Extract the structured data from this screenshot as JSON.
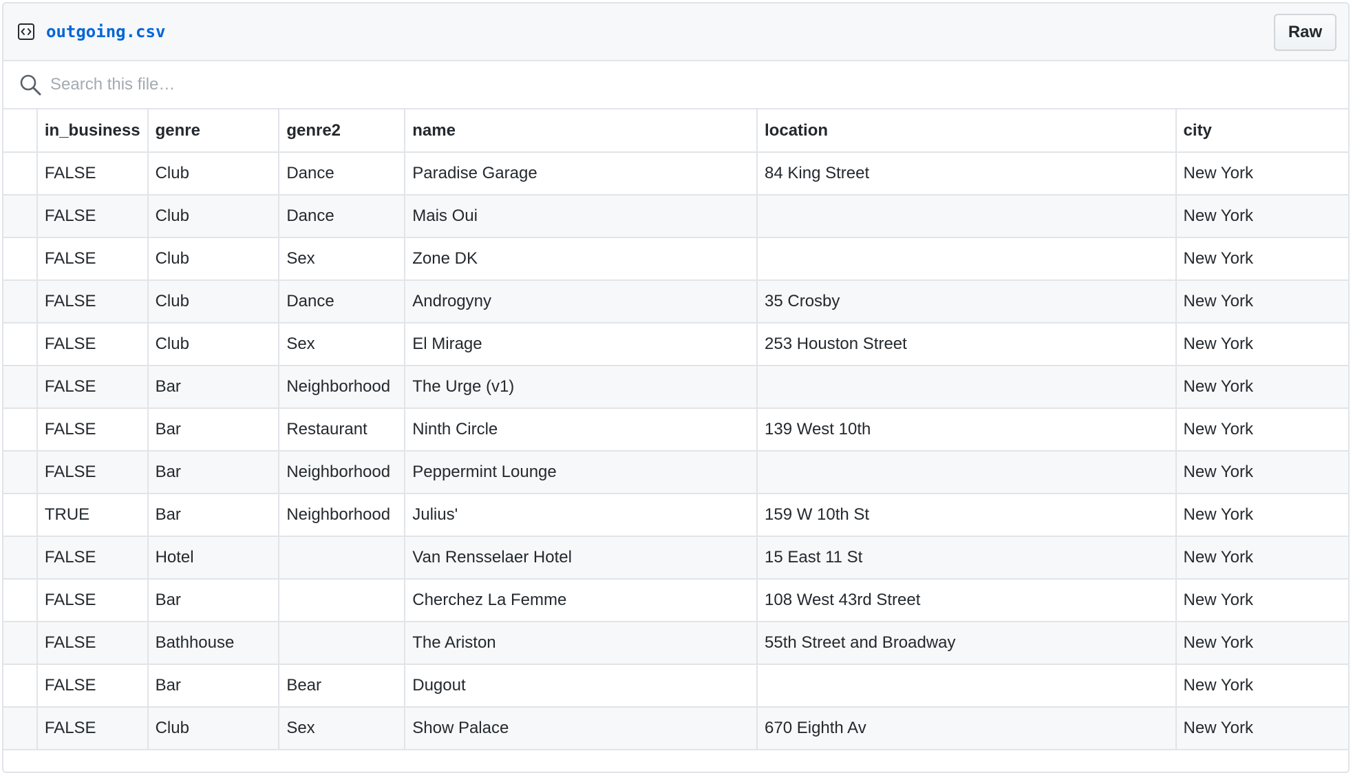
{
  "file": {
    "name": "outgoing.csv",
    "raw_label": "Raw"
  },
  "search": {
    "placeholder": "Search this file…",
    "value": ""
  },
  "icons": {
    "file_icon": "file-code-icon",
    "search_icon": "search-icon"
  },
  "colors": {
    "link": "#0366d6",
    "border": "#e1e4e8",
    "header_bg": "#f6f8fa",
    "stripe_bg": "#f6f8fa",
    "text": "#24292e",
    "placeholder": "#a3aab1"
  },
  "table": {
    "columns": [
      "in_business",
      "genre",
      "genre2",
      "name",
      "location",
      "city"
    ],
    "rows": [
      [
        "FALSE",
        "Club",
        "Dance",
        "Paradise Garage",
        "84 King Street",
        "New York"
      ],
      [
        "FALSE",
        "Club",
        "Dance",
        "Mais Oui",
        "",
        "New York"
      ],
      [
        "FALSE",
        "Club",
        "Sex",
        "Zone DK",
        "",
        "New York"
      ],
      [
        "FALSE",
        "Club",
        "Dance",
        "Androgyny",
        "35 Crosby",
        "New York"
      ],
      [
        "FALSE",
        "Club",
        "Sex",
        "El Mirage",
        "253 Houston Street",
        "New York"
      ],
      [
        "FALSE",
        "Bar",
        "Neighborhood",
        "The Urge (v1)",
        "",
        "New York"
      ],
      [
        "FALSE",
        "Bar",
        "Restaurant",
        "Ninth Circle",
        "139 West 10th",
        "New York"
      ],
      [
        "FALSE",
        "Bar",
        "Neighborhood",
        "Peppermint Lounge",
        "",
        "New York"
      ],
      [
        "TRUE",
        "Bar",
        "Neighborhood",
        "Julius'",
        "159 W 10th St",
        "New York"
      ],
      [
        "FALSE",
        "Hotel",
        "",
        "Van Rensselaer Hotel",
        "15 East 11 St",
        "New York"
      ],
      [
        "FALSE",
        "Bar",
        "",
        "Cherchez La Femme",
        "108 West 43rd Street",
        "New York"
      ],
      [
        "FALSE",
        "Bathhouse",
        "",
        "The Ariston",
        "55th Street and Broadway",
        "New York"
      ],
      [
        "FALSE",
        "Bar",
        "Bear",
        "Dugout",
        "",
        "New York"
      ],
      [
        "FALSE",
        "Club",
        "Sex",
        "Show Palace",
        "670 Eighth Av",
        "New York"
      ]
    ]
  }
}
